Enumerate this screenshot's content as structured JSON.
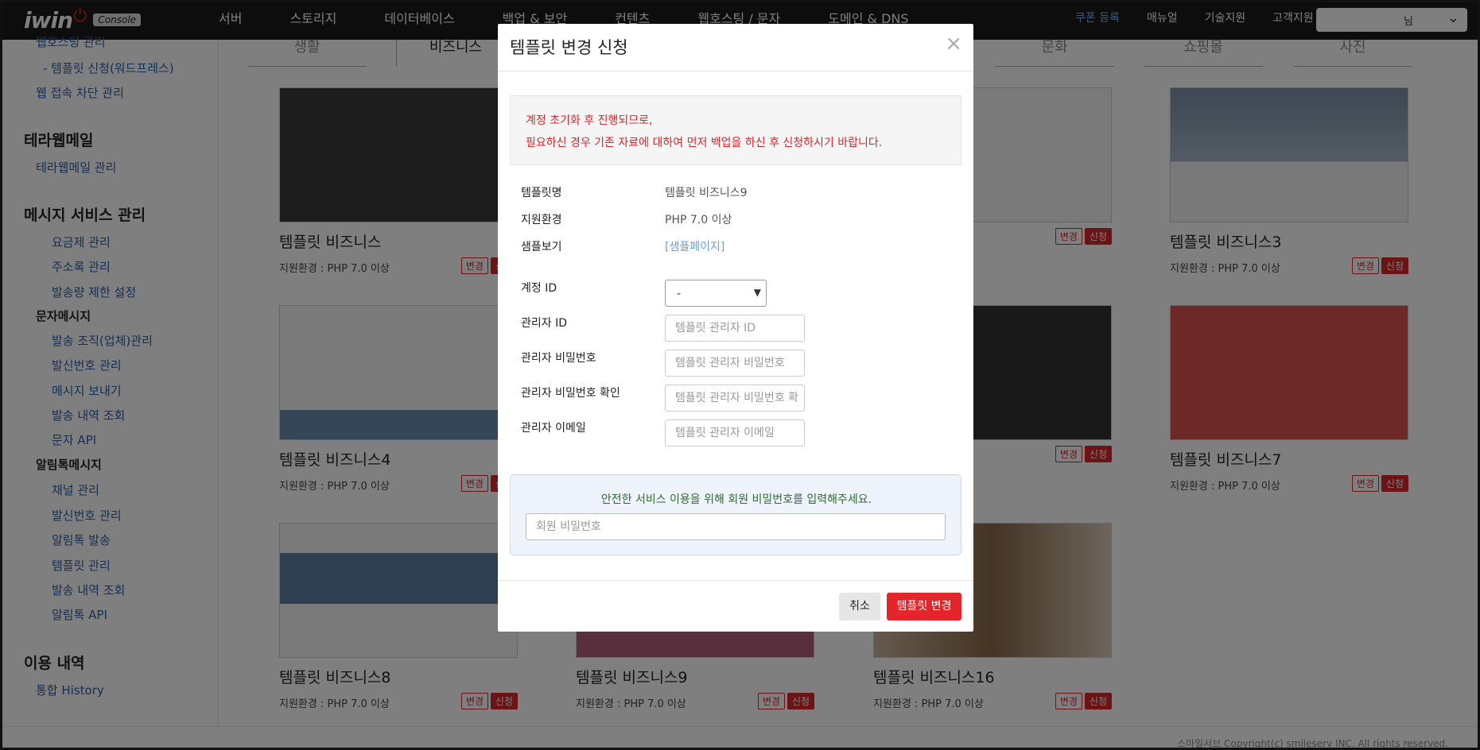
{
  "header": {
    "logo_text": "iwin",
    "logo_badge": "Console",
    "menu": [
      "서버",
      "스토리지",
      "데이터베이스",
      "백업 & 보안",
      "컨텐츠",
      "웹호스팅 / 문자",
      "도메인 & DNS"
    ],
    "right_menu": [
      "쿠폰 등록",
      "매뉴얼",
      "기술지원",
      "고객지원"
    ],
    "user_suffix": "님"
  },
  "sidebar": {
    "top_items": [
      "웹호스팅 관리",
      "- 템플릿 신청(워드프레스)",
      "웹 접속 차단 관리"
    ],
    "sections": [
      {
        "title": "테라웹메일",
        "items": [
          "테라웹메일 관리"
        ]
      },
      {
        "title": "메시지 서비스 관리",
        "items": [
          "요금제 관리",
          "주소록 관리",
          "발송량 제한 설정"
        ]
      },
      {
        "subtitle": "문자메시지",
        "items": [
          "발송 조직(업체)관리",
          "발신번호 관리",
          "메시지 보내기",
          "발송 내역 조회",
          "문자 API"
        ]
      },
      {
        "subtitle": "알림톡메시지",
        "items": [
          "채널 관리",
          "발신번호 관리",
          "알림톡 발송",
          "템플릿 관리",
          "발송 내역 조회",
          "알림톡 API"
        ]
      },
      {
        "title": "이용 내역",
        "items": [
          "통합 History"
        ]
      }
    ]
  },
  "tabs": [
    "생활",
    "비즈니스",
    "",
    "",
    "문화",
    "쇼핑몰",
    "사진"
  ],
  "cards": [
    {
      "title": "템플릿 비즈니스",
      "env": "지원환경 : PHP 7.0 이상",
      "thumb_color": "#3a3a3a"
    },
    {
      "title": "",
      "env": "",
      "thumb_color": "#eee"
    },
    {
      "title": "",
      "env": "",
      "thumb_color": "#f4f4f4"
    },
    {
      "title": "템플릿 비즈니스3",
      "env": "지원환경 : PHP 7.0 이상",
      "thumb_color": "#7c8fa6"
    },
    {
      "title": "템플릿 비즈니스4",
      "env": "지원환경 : PHP 7.0 이상",
      "thumb_color": "#f2f2f2"
    },
    {
      "title": "",
      "env": "",
      "thumb_color": "#ccc"
    },
    {
      "title": "",
      "env": "",
      "thumb_color": "#333"
    },
    {
      "title": "템플릿 비즈니스7",
      "env": "지원환경 : PHP 7.0 이상",
      "thumb_color": "#d9534f"
    },
    {
      "title": "템플릿 비즈니스8",
      "env": "지원환경 : PHP 7.0 이상",
      "thumb_color": "#5a7fa0"
    },
    {
      "title": "템플릿 비즈니스9",
      "env": "지원환경 : PHP 7.0 이상",
      "thumb_color": "#b0607a"
    },
    {
      "title": "템플릿 비즈니스16",
      "env": "지원환경 : PHP 7.0 이상",
      "thumb_color": "#8a6a4a"
    }
  ],
  "card_buttons": {
    "change": "변경",
    "apply": "신청"
  },
  "footer": {
    "copyright": "스마일서브 Copyright(c) smileserv INC. All rights reserved."
  },
  "modal": {
    "title": "템플릿 변경 신청",
    "close": "×",
    "warning_line1": "계정 초기화 후 진행되므로,",
    "warning_line2": "필요하신 경우 기존 자료에 대하여 먼저 백업을 하신 후 신청하시기 바랍니다.",
    "fields": {
      "template_name_label": "템플릿명",
      "template_name_value": "템플릿 비즈니스9",
      "env_label": "지원환경",
      "env_value": "PHP 7.0 이상",
      "sample_label": "샘플보기",
      "sample_value": "[샘플페이지]",
      "account_label": "계정 ID",
      "account_value": "-",
      "admin_id_label": "관리자 ID",
      "admin_id_placeholder": "템플릿 관리자 ID",
      "admin_pw_label": "관리자 비밀번호",
      "admin_pw_placeholder": "템플릿 관리자 비밀번호",
      "admin_pw_confirm_label": "관리자 비밀번호 확인",
      "admin_pw_confirm_placeholder": "템플릿 관리자 비밀번호 확",
      "admin_email_label": "관리자 이메일",
      "admin_email_placeholder": "템플릿 관리자 이메일"
    },
    "pw_notice": "안전한 서비스 이용을 위해 회원 비밀번호를 입력해주세요.",
    "pw_placeholder": "회원 비밀번호",
    "cancel": "취소",
    "submit": "템플릿 변경"
  }
}
